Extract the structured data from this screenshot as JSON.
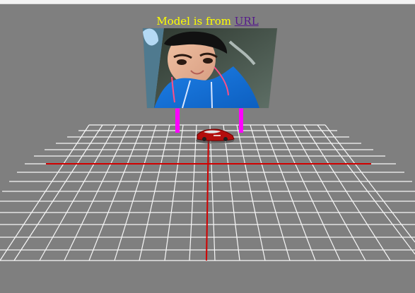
{
  "scene": {
    "caption_text": "Model is from ",
    "caption_link": "URL",
    "billboard_image": "portrait photo of a person in a blue jacket",
    "colors": {
      "background": "#808080",
      "caption": "#ffff00",
      "link": "#551a8b",
      "grid": "#ffffff",
      "axis": "#ff0000",
      "posts": "#ff00ff",
      "car": "#b30d0d"
    }
  }
}
